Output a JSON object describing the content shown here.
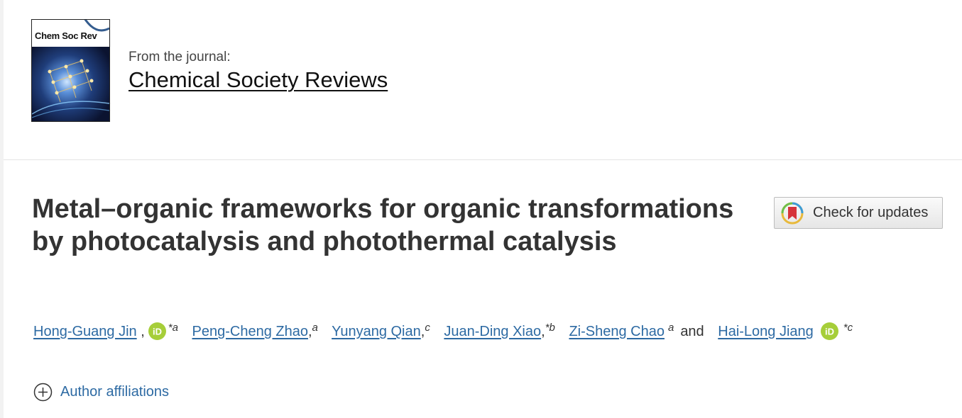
{
  "journal": {
    "cover_title": "Chem Soc Rev",
    "from_label": "From the journal:",
    "name": "Chemical Society Reviews"
  },
  "article": {
    "title": "Metal–organic frameworks for organic transformations by photocatalysis and photothermal catalysis"
  },
  "check_updates": {
    "label": "Check for updates"
  },
  "authors": [
    {
      "name": "Hong-Guang Jin",
      "orcid": true,
      "corresponding": true,
      "aff": "a"
    },
    {
      "name": "Peng-Cheng Zhao",
      "orcid": false,
      "corresponding": false,
      "aff": "a"
    },
    {
      "name": "Yunyang Qian",
      "orcid": false,
      "corresponding": false,
      "aff": "c"
    },
    {
      "name": "Juan-Ding Xiao",
      "orcid": false,
      "corresponding": true,
      "aff": "b"
    },
    {
      "name": "Zi-Sheng Chao",
      "orcid": false,
      "corresponding": false,
      "aff": "a"
    },
    {
      "name": "Hai-Long Jiang",
      "orcid": true,
      "corresponding": true,
      "aff": "c"
    }
  ],
  "authors_conjunction": "and",
  "affiliations_toggle": {
    "label": "Author affiliations"
  },
  "colors": {
    "link": "#2d6aa3",
    "title_text": "#333333",
    "orcid_green": "#a6ce39"
  }
}
